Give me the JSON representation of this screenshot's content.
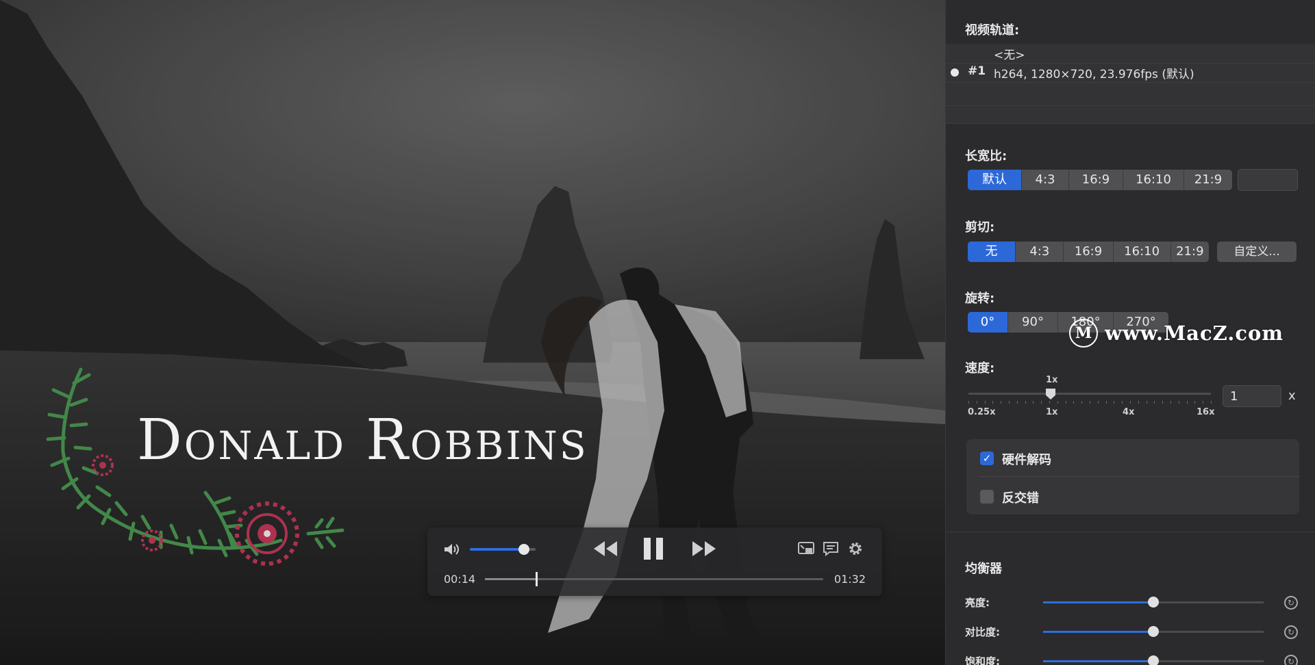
{
  "video": {
    "watermark_title": "Donald Robbins"
  },
  "player": {
    "volume_level": 0.82,
    "progress_fraction": 0.152,
    "time_current": "00:14",
    "time_total": "01:32",
    "icons": [
      "speaker-icon",
      "rewind-icon",
      "pause-icon",
      "fast-forward-icon",
      "pip-icon",
      "subtitle-icon",
      "gear-icon"
    ]
  },
  "watermark": {
    "logo_letter": "M",
    "text": "www.MacZ.com"
  },
  "panel": {
    "video_track": {
      "title": "视频轨道:",
      "tracks": [
        {
          "num": "",
          "label": "<无>",
          "selected": false
        },
        {
          "num": "#1",
          "label": "h264, 1280×720, 23.976fps (默认)",
          "selected": true
        }
      ]
    },
    "aspect": {
      "title": "长宽比:",
      "options": [
        "默认",
        "4:3",
        "16:9",
        "16:10",
        "21:9"
      ],
      "selected_index": 0,
      "custom_value": ""
    },
    "crop": {
      "title": "剪切:",
      "options": [
        "无",
        "4:3",
        "16:9",
        "16:10",
        "21:9"
      ],
      "selected_index": 0,
      "custom_button": "自定义..."
    },
    "rotate": {
      "title": "旋转:",
      "options": [
        "0°",
        "90°",
        "180°",
        "270°"
      ],
      "selected_index": 0
    },
    "speed": {
      "title": "速度:",
      "current_label": "1x",
      "labels": [
        "0.25x",
        "1x",
        "4x",
        "16x"
      ],
      "value": "1",
      "unit": "x"
    },
    "options": {
      "hardware_decode": {
        "label": "硬件解码",
        "checked": true
      },
      "deinterlace": {
        "label": "反交错",
        "checked": false
      }
    },
    "equalizer": {
      "title": "均衡器",
      "rows": [
        {
          "label": "亮度:",
          "value": 0.5
        },
        {
          "label": "对比度:",
          "value": 0.5
        },
        {
          "label": "饱和度:",
          "value": 0.5
        }
      ]
    }
  },
  "colors": {
    "accent": "#2d68d8",
    "panel_bg": "#2b2b2d"
  }
}
